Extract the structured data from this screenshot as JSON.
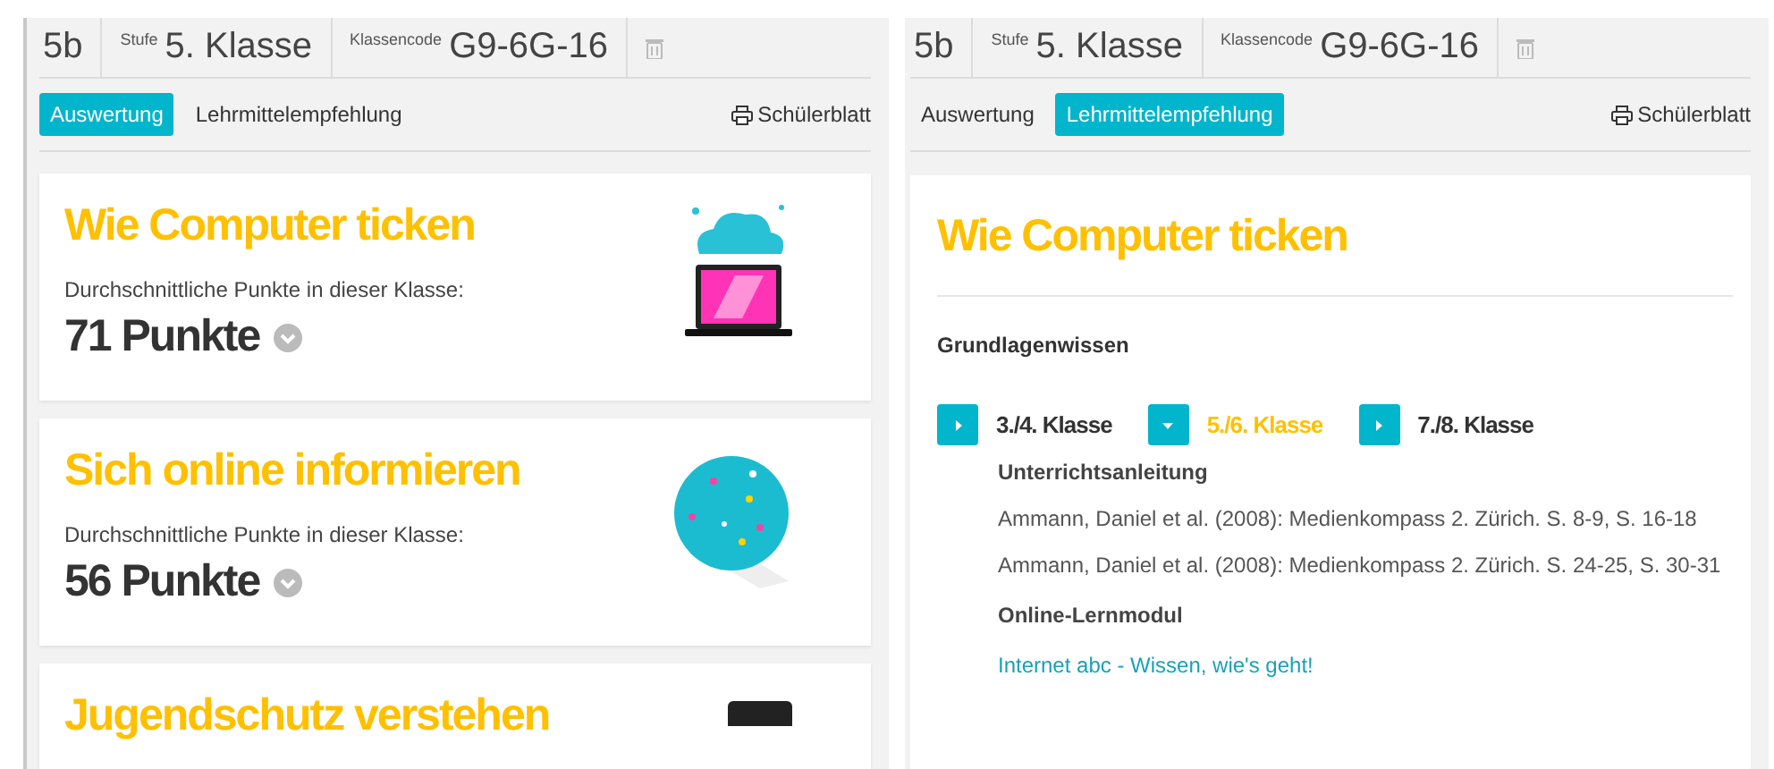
{
  "panels": [
    {
      "header": {
        "class_name": "5b",
        "level_label": "Stufe",
        "level": "5. Klasse",
        "code_label": "Klassencode",
        "code": "G9-6G-16"
      },
      "tabs": [
        {
          "label": "Auswertung",
          "selected": true
        },
        {
          "label": "Lehrmittelempfehlung",
          "selected": false
        }
      ],
      "print": "Schülerblatt",
      "kind": "evaluation",
      "cards": [
        {
          "title": "Wie Computer ticken",
          "caption": "Durchschnittliche Punkte in dieser Klasse:",
          "score": "71 Punkte",
          "kind": "laptop"
        },
        {
          "title": "Sich online informieren",
          "caption": "Durchschnittliche Punkte in dieser Klasse:",
          "score": "56 Punkte",
          "kind": "globe"
        },
        {
          "title": "Jugendschutz verstehen",
          "kind": "device"
        }
      ]
    },
    {
      "header": {
        "class_name": "5b",
        "level_label": "Stufe",
        "level": "5. Klasse",
        "code_label": "Klassencode",
        "code": "G9-6G-16"
      },
      "tabs": [
        {
          "label": "Auswertung",
          "selected": false
        },
        {
          "label": "Lehrmittelempfehlung",
          "selected": true
        }
      ],
      "print": "Schülerblatt",
      "kind": "recommendation",
      "topic": {
        "title": "Wie Computer ticken",
        "section": "Grundlagenwissen",
        "levels": [
          {
            "label": "3./4. Klasse",
            "selected": false
          },
          {
            "label": "5./6. Klasse",
            "selected": true
          },
          {
            "label": "7./8. Klasse",
            "selected": false
          }
        ],
        "groups": [
          {
            "heading": "Unterrichtsanleitung",
            "items": [
              {
                "kind": "text",
                "text": "Ammann, Daniel et al. (2008): Medienkompass 2. Zürich. S. 8-9, S. 16-18"
              },
              {
                "kind": "text",
                "text": "Ammann, Daniel et al. (2008): Medienkompass 2. Zürich. S. 24-25, S. 30-31"
              }
            ]
          },
          {
            "heading": "Online-Lernmodul",
            "items": [
              {
                "kind": "link",
                "text": "Internet abc - Wissen, wie's geht!"
              }
            ]
          }
        ]
      }
    }
  ]
}
